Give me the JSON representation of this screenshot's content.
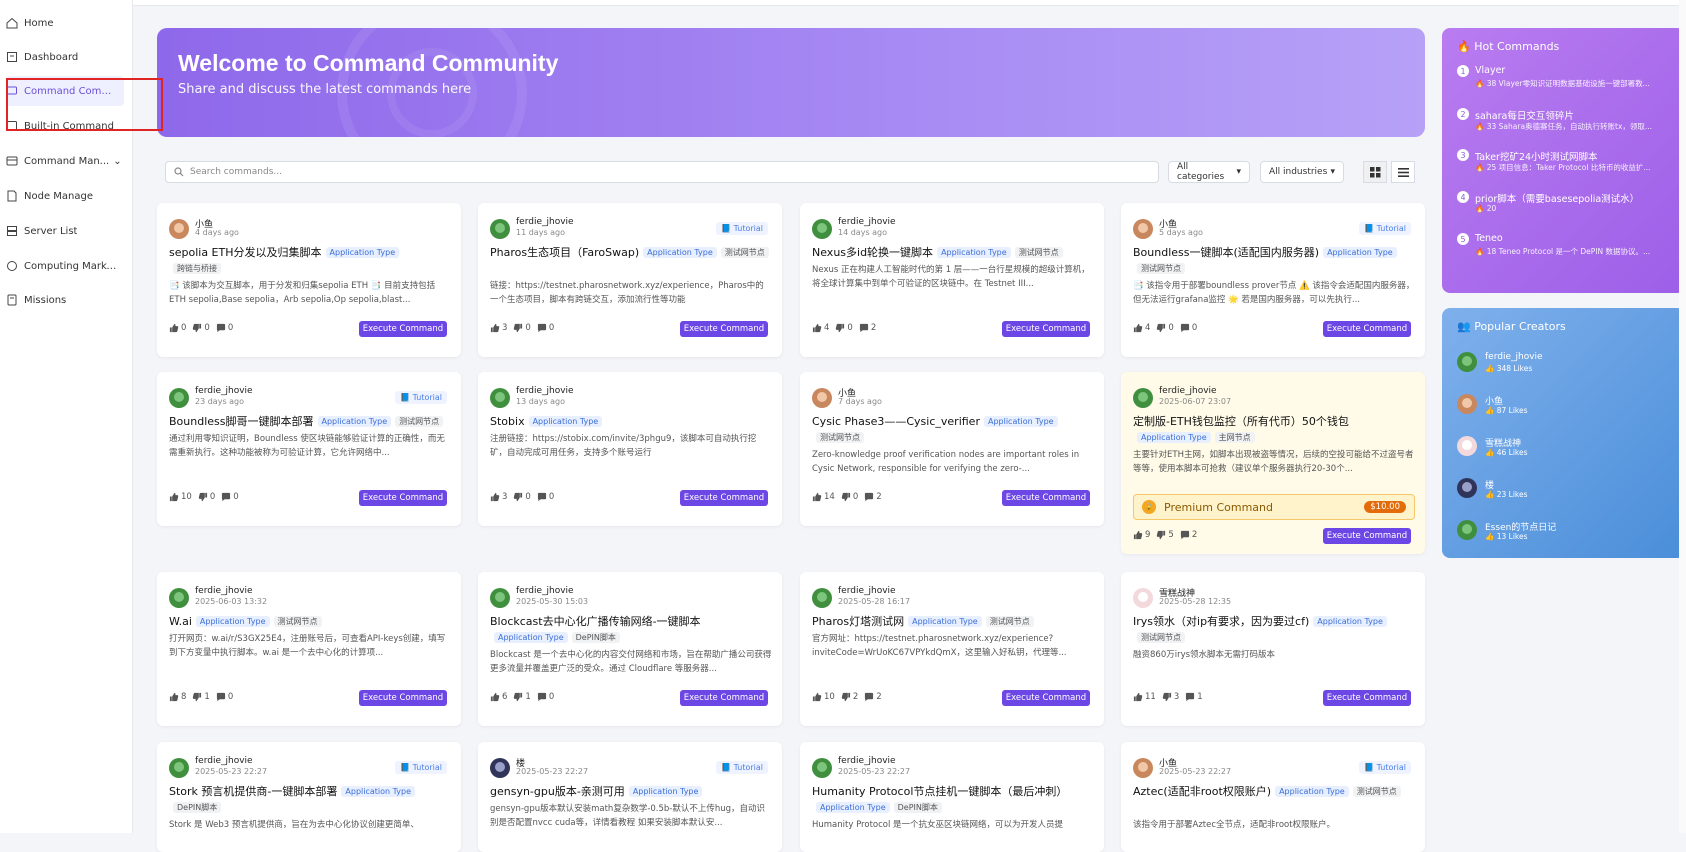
{
  "sidebar": {
    "items": [
      {
        "label": "Home",
        "icon": "home-icon"
      },
      {
        "label": "Dashboard",
        "icon": "dashboard-icon"
      },
      {
        "label": "Command Commu...",
        "icon": "community-icon"
      },
      {
        "label": "Built-in Command",
        "icon": "built-in-icon"
      },
      {
        "label": "Command Man...",
        "icon": "command-manage-icon"
      },
      {
        "label": "Node Manage",
        "icon": "node-icon"
      },
      {
        "label": "Server List",
        "icon": "server-icon"
      },
      {
        "label": "Computing Market...",
        "icon": "market-icon"
      },
      {
        "label": "Missions",
        "icon": "missions-icon"
      }
    ]
  },
  "banner": {
    "title": "Welcome to Command Community",
    "subtitle": "Share and discuss the latest commands here"
  },
  "search": {
    "placeholder": "Search commands..."
  },
  "filters": {
    "categories": "All categories",
    "industries": "All industries"
  },
  "colors": {
    "accent": "#6c47e6",
    "tag_blue": "#3b6fd6",
    "premium": "#e46b0a"
  },
  "cards": [
    {
      "user": "小鱼",
      "date": "4 days ago",
      "tutorial": "",
      "title": "sepolia ETH分发以及归集脚本",
      "tags": [
        "Application Type",
        "跨链与桥接"
      ],
      "desc": "📑 该脚本为交互脚本，用于分发和归集sepolia ETH 📑 目前支持包括ETH sepolia,Base sepolia，Arb sepolia,Op sepolia,blast...",
      "likes": "0",
      "dislikes": "0",
      "comments": "0",
      "exec": "Execute Command"
    },
    {
      "user": "ferdie_jhovie",
      "date": "11 days ago",
      "tutorial": "Tutorial",
      "title": "Pharos生态项目（FaroSwap)",
      "tags": [
        "Application Type",
        "测试网节点"
      ],
      "desc": "链接：https://testnet.pharosnetwork.xyz/experience，Pharos中的一个生态项目，脚本有跨链交互，添加流行性等功能",
      "likes": "3",
      "dislikes": "0",
      "comments": "0",
      "exec": "Execute Command"
    },
    {
      "user": "ferdie_jhovie",
      "date": "14 days ago",
      "tutorial": "",
      "title": "Nexus多id轮换一键脚本",
      "tags": [
        "Application Type",
        "测试网节点"
      ],
      "desc": "Nexus 正在构建人工智能时代的第 1 层——一台行星规模的超级计算机，将全球计算集中到单个可验证的区块链中。在 Testnet III...",
      "likes": "4",
      "dislikes": "0",
      "comments": "2",
      "exec": "Execute Command"
    },
    {
      "user": "小鱼",
      "date": "5 days ago",
      "tutorial": "Tutorial",
      "title": "Boundless一键脚本(适配国内服务器)",
      "tags": [
        "Application Type",
        "测试网节点"
      ],
      "desc": "📑 该指令用于部署boundless prover节点 ⚠️ 该指令会适配国内服务器，但无法运行grafana监控 🌟 若是国内服务器，可以先执行...",
      "likes": "4",
      "dislikes": "0",
      "comments": "0",
      "exec": "Execute Command"
    },
    {
      "user": "ferdie_jhovie",
      "date": "23 days ago",
      "tutorial": "Tutorial",
      "title": "Boundless脚哥一键脚本部署",
      "tags": [
        "Application Type",
        "测试网节点"
      ],
      "desc": "通过利用零知识证明，Boundless 使区块链能够验证计算的正确性，而无需重新执行。这种功能被称为可验证计算，它允许网络中...",
      "likes": "10",
      "dislikes": "0",
      "comments": "0",
      "exec": "Execute Command"
    },
    {
      "user": "ferdie_jhovie",
      "date": "13 days ago",
      "tutorial": "",
      "title": "Stobix",
      "tags": [
        "Application Type"
      ],
      "desc": "注册链接：https://stobix.com/invite/3phgu9，该脚本可自动执行挖矿，自动完成可用任务，支持多个账号运行",
      "likes": "3",
      "dislikes": "0",
      "comments": "0",
      "exec": "Execute Command"
    },
    {
      "user": "小鱼",
      "date": "7 days ago",
      "tutorial": "",
      "title": "Cysic Phase3——Cysic_verifier",
      "tags": [
        "Application Type",
        "测试网节点"
      ],
      "desc": "Zero-knowledge proof verification nodes are important roles in Cysic Network, responsible for verifying the zero-...",
      "likes": "14",
      "dislikes": "0",
      "comments": "2",
      "exec": "Execute Command"
    },
    {
      "user": "ferdie_jhovie",
      "date": "2025-06-07 23:07",
      "tutorial": "",
      "title": "定制版-ETH钱包监控（所有代币）50个钱包",
      "tags": [
        "Application Type",
        "主网节点"
      ],
      "desc": "主要针对ETH主网，如脚本出现被盗等情况，后续的空投可能给不过盗号者等等，使用本脚本可抢救（建议单个服务器执行20-30个...",
      "likes": "9",
      "dislikes": "5",
      "comments": "2",
      "exec": "Execute Command",
      "premium": "Premium Command",
      "price": "$10.00"
    },
    {
      "user": "ferdie_jhovie",
      "date": "2025-06-03 13:32",
      "tutorial": "",
      "title": "W.ai",
      "tags": [
        "Application Type",
        "测试网节点"
      ],
      "desc": "打开网页：w.ai/r/S3GX25E4，注册账号后，可查看API-keys创建，填写到下方变量中执行脚本。w.ai 是一个去中心化的计算项...",
      "likes": "8",
      "dislikes": "1",
      "comments": "0",
      "exec": "Execute Command"
    },
    {
      "user": "ferdie_jhovie",
      "date": "2025-05-30 15:03",
      "tutorial": "",
      "title": "Blockcast去中心化广播传输网络-一键脚本",
      "tags": [
        "Application Type",
        "DePIN脚本"
      ],
      "desc": "Blockcast 是一个去中心化的内容交付网络和市场，旨在帮助广播公司获得更多流量并覆盖更广泛的受众。通过 Cloudflare 等服务器...",
      "likes": "6",
      "dislikes": "1",
      "comments": "0",
      "exec": "Execute Command"
    },
    {
      "user": "ferdie_jhovie",
      "date": "2025-05-28 16:17",
      "tutorial": "",
      "title": "Pharos灯塔测试网",
      "tags": [
        "Application Type",
        "测试网节点"
      ],
      "desc": "官方网址：https://testnet.pharosnetwork.xyz/experience?inviteCode=WrUoKC67VPYkdQmX，这里输入好私钥，代理等...",
      "likes": "10",
      "dislikes": "2",
      "comments": "2",
      "exec": "Execute Command"
    },
    {
      "user": "雪糕战神",
      "date": "2025-05-28 12:35",
      "tutorial": "",
      "title": "Irys领水（对ip有要求，因为要过cf)",
      "tags": [
        "Application Type",
        "测试网节点"
      ],
      "desc": "融资860万irys领水脚本无需打码版本",
      "likes": "11",
      "dislikes": "3",
      "comments": "1",
      "exec": "Execute Command"
    },
    {
      "user": "ferdie_jhovie",
      "date": "2025-05-23 22:27",
      "tutorial": "Tutorial",
      "title": "Stork 预言机提供商-一键脚本部署",
      "tags": [
        "Application Type",
        "DePIN脚本"
      ],
      "desc": "Stork 是 Web3 预言机提供商，旨在为去中心化协议创建更简单、",
      "likes": "",
      "dislikes": "",
      "comments": "",
      "exec": ""
    },
    {
      "user": "楼",
      "date": "2025-05-23 22:27",
      "tutorial": "Tutorial",
      "title": "gensyn-gpu版本-亲测可用",
      "tags": [
        "Application Type"
      ],
      "desc": "gensyn-gpu版本默认安装math复杂数学-0.5b-默认不上传hug，自动识别是否配置nvcc cuda等，详情看教程 如果安装脚本默认安...",
      "likes": "",
      "dislikes": "",
      "comments": "",
      "exec": ""
    },
    {
      "user": "ferdie_jhovie",
      "date": "2025-05-23 22:27",
      "tutorial": "",
      "title": "Humanity Protocol节点挂机一键脚本（最后冲刺）",
      "tags": [
        "Application Type",
        "DePIN脚本"
      ],
      "desc": "Humanity Protocol 是一个抗女巫区块链网络，可以为开发人员提",
      "likes": "",
      "dislikes": "",
      "comments": "",
      "exec": ""
    },
    {
      "user": "小鱼",
      "date": "2025-05-23 22:27",
      "tutorial": "Tutorial",
      "title": "Aztec(适配非root权限账户)",
      "tags": [
        "Application Type",
        "测试网节点"
      ],
      "desc": "该指令用于部署Aztec全节点，适配非root权限账户。",
      "likes": "",
      "dislikes": "",
      "comments": "",
      "exec": ""
    }
  ],
  "hot": {
    "title": "Hot Commands",
    "items": [
      {
        "num": "1",
        "name": "Vlayer",
        "sub": "🔥 38  Vlayer零知识证明数据基础设施一键部署教..."
      },
      {
        "num": "2",
        "name": "sahara每日交互领碎片",
        "sub": "🔥 33  Sahara奥德赛任务，自动执行转账tx，领取..."
      },
      {
        "num": "3",
        "name": "Taker挖矿24小时测试网脚本",
        "sub": "🔥 25  项目信息：Taker Protocol 比特币的收益扩..."
      },
      {
        "num": "4",
        "name": "prior脚本（需要basesepolia测试水）",
        "sub": "🔥 20"
      },
      {
        "num": "5",
        "name": "Teneo",
        "sub": "🔥 18  Teneo Protocol 是一个 DePIN 数据协议。..."
      }
    ]
  },
  "creators": {
    "title": "Popular Creators",
    "items": [
      {
        "name": "ferdie_jhovie",
        "likes": "👍 348 Likes"
      },
      {
        "name": "小鱼",
        "likes": "👍 87 Likes"
      },
      {
        "name": "雪糕战神",
        "likes": "👍 46 Likes"
      },
      {
        "name": "楼",
        "likes": "👍 23 Likes"
      },
      {
        "name": "Essen的节点日记",
        "likes": "👍 13 Likes"
      }
    ]
  }
}
